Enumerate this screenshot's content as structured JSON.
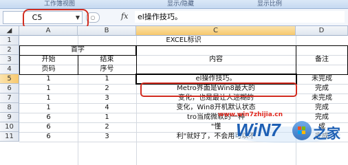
{
  "ribbon": {
    "groups": [
      "工作簿视图",
      "显示/隐藏",
      "显示比例"
    ]
  },
  "formula_bar": {
    "cell_ref": "C5",
    "fx_label": "fx",
    "value": "el操作技巧。"
  },
  "columns": [
    "A",
    "B",
    "C",
    "D"
  ],
  "rows": [
    "1",
    "2",
    "3",
    "4",
    "5",
    "6",
    "7",
    "8",
    "9",
    "10",
    "11"
  ],
  "sheet": {
    "title": "EXCEL标识",
    "header_group": "首字",
    "a3": "开始",
    "b3": "结束",
    "a4": "页码",
    "b4": "序号",
    "c_header": "内容",
    "d_header": "备注",
    "data_rows": [
      {
        "a": "1",
        "b": "1",
        "c": "el操作技巧。",
        "d": "未完成"
      },
      {
        "a": "1",
        "b": "2",
        "c": "Metro界面是Win8最大的",
        "d": "完成"
      },
      {
        "a": "1",
        "b": "3",
        "c": "变化，也是最让人迷糊的",
        "d": "未完成"
      },
      {
        "a": "1",
        "b": "4",
        "c": "变化，Win8开机默认状态",
        "d": "完成"
      },
      {
        "a": "6",
        "b": "1",
        "c": "tro当成微软的一种",
        "d": "完成"
      },
      {
        "a": "6",
        "b": "2",
        "c": "\"懂",
        "d": "成"
      },
      {
        "a": "6",
        "b": "3",
        "c": "利\"就好了，不会用可以不",
        "d": "完成"
      }
    ]
  },
  "watermark": {
    "site": "www.win7zhijia.cn",
    "logo": "WiN7",
    "suffix": "之家"
  },
  "colors": {
    "annotation": "#d12b1f",
    "selection": "#f7c86d"
  }
}
